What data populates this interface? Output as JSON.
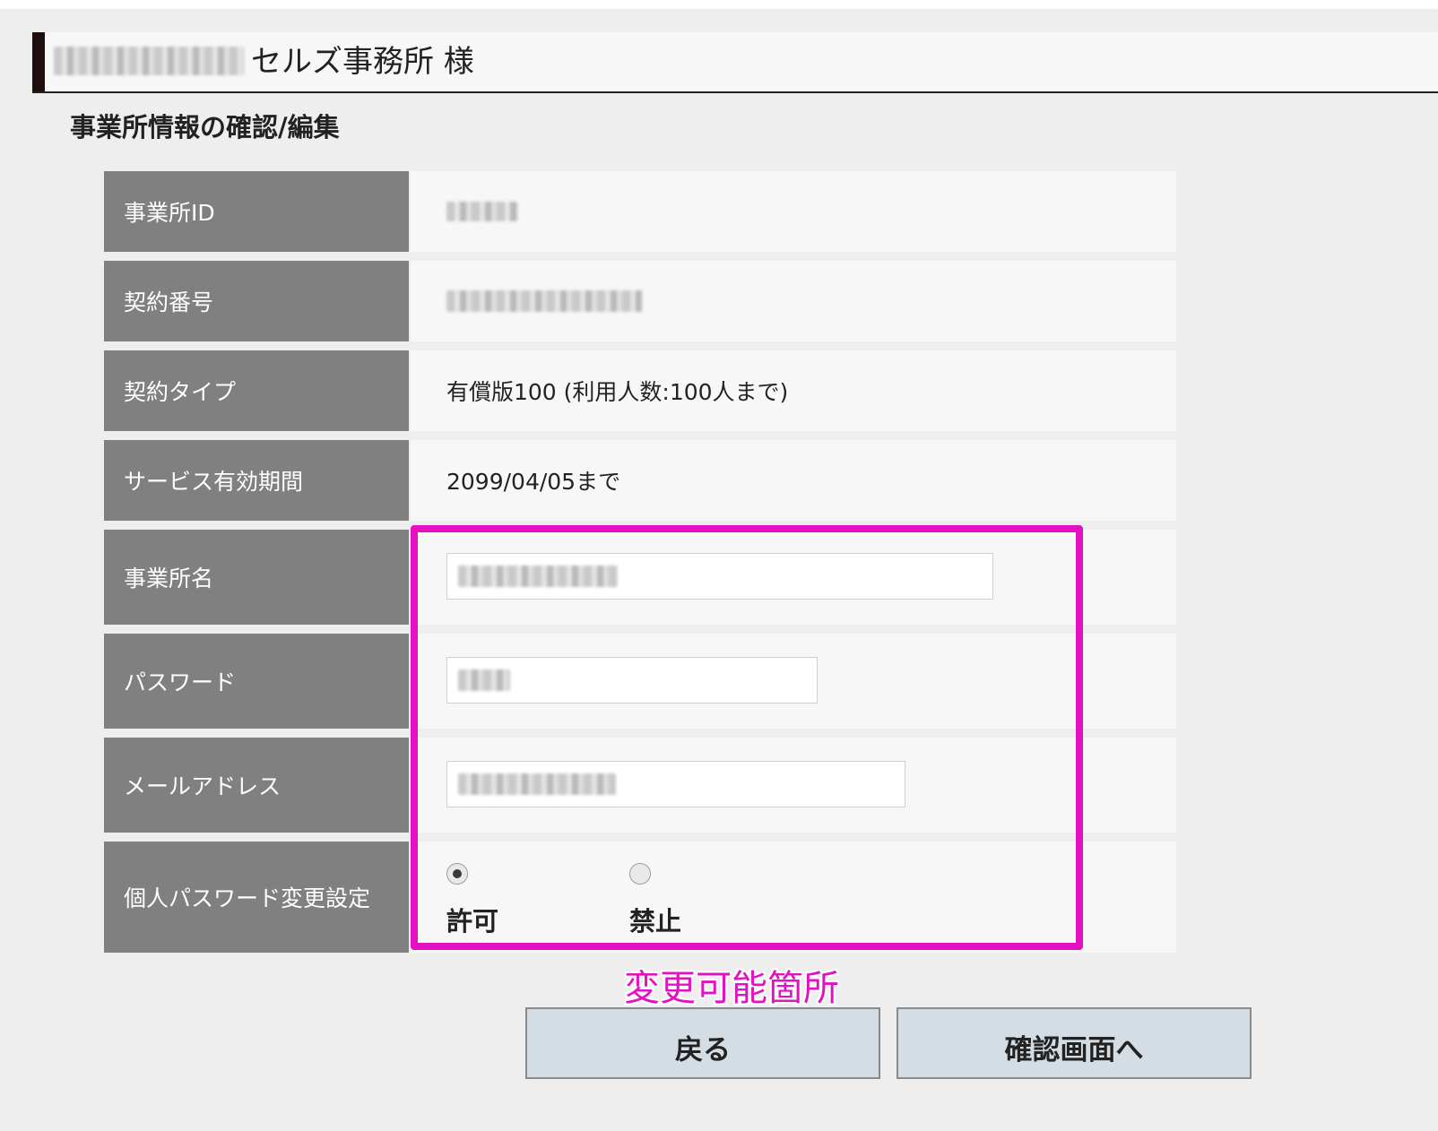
{
  "header": {
    "title": "セルズ事務所 様"
  },
  "section_title": "事業所情報の確認/編集",
  "rows": [
    {
      "label": "事業所ID",
      "value": ""
    },
    {
      "label": "契約番号",
      "value": ""
    },
    {
      "label": "契約タイプ",
      "value": "有償版100 (利用人数:100人まで)"
    },
    {
      "label": "サービス有効期間",
      "value": "2099/04/05まで"
    },
    {
      "label": "事業所名"
    },
    {
      "label": "パスワード"
    },
    {
      "label": "メールアドレス"
    },
    {
      "label": "個人パスワード変更設定"
    }
  ],
  "password_change_setting": {
    "options": [
      {
        "label": "許可",
        "checked": true
      },
      {
        "label": "禁止",
        "checked": false
      }
    ]
  },
  "annotation": {
    "label": "変更可能箇所",
    "color": "#e212c2"
  },
  "buttons": {
    "back": "戻る",
    "confirm": "確認画面へ"
  },
  "colors": {
    "label_bg": "#808080",
    "value_bg": "#f7f7f7",
    "page_bg": "#eeeeee",
    "button_bg": "#d4dde3",
    "header_accent": "#1e0e0c"
  }
}
